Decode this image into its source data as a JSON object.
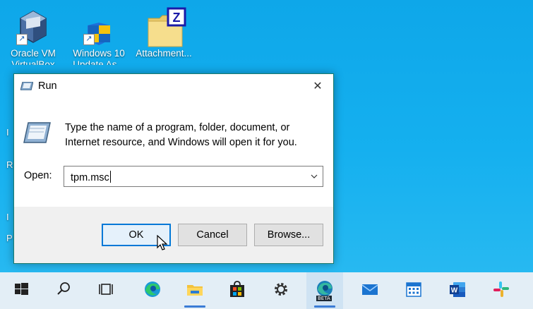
{
  "desktop": {
    "icons": [
      {
        "label": "Oracle VM",
        "label2": "VirtualBox",
        "icon": "virtualbox-icon"
      },
      {
        "label": "Windows 10",
        "label2": "Update As...",
        "icon": "windows-shield-icon"
      },
      {
        "label": "Attachment...",
        "label2": "",
        "icon": "zipped-folder-icon"
      }
    ],
    "partial_labels": [
      "I",
      "R",
      "I",
      "P"
    ]
  },
  "run_dialog": {
    "title": "Run",
    "close": "✕",
    "description": "Type the name of a program, folder, document, or Internet resource, and Windows will open it for you.",
    "open_label": "Open:",
    "open_value": "tpm.msc",
    "buttons": {
      "ok": "OK",
      "cancel": "Cancel",
      "browse": "Browse..."
    }
  },
  "taskbar": {
    "items": [
      "start-icon",
      "search-icon",
      "task-view-icon",
      "edge-icon",
      "file-explorer-icon",
      "microsoft-store-icon",
      "settings-gear-icon",
      "edge-beta-icon",
      "mail-icon",
      "calendar-icon",
      "word-icon",
      "slack-icon"
    ],
    "beta_badge": "BETA"
  }
}
